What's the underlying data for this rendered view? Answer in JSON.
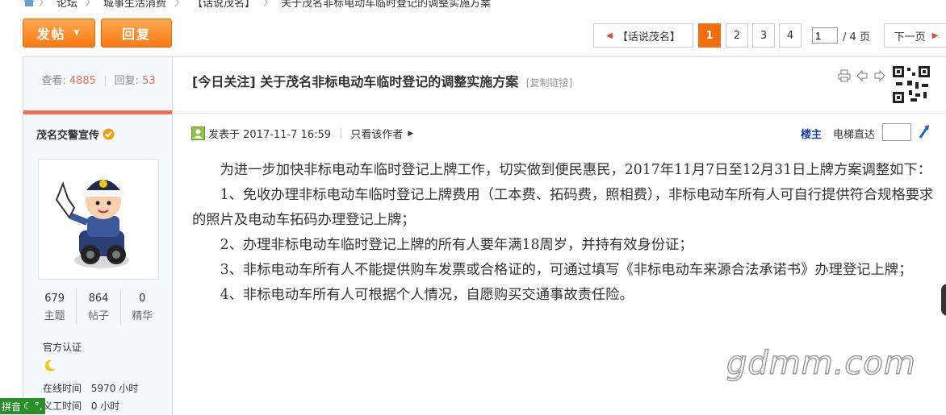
{
  "breadcrumb": {
    "items": [
      "论坛",
      "城事生活消费",
      "【话说茂名】",
      "关于茂名非标电动车临时登记的调整实施方案"
    ]
  },
  "toolbar": {
    "post_label": "发帖",
    "reply_label": "回复"
  },
  "pagination": {
    "back_label": "【话说茂名】",
    "pages": [
      "1",
      "2",
      "3",
      "4"
    ],
    "current_page": "1",
    "page_input": "1",
    "total_label": "/ 4 页",
    "next_label": "下一页"
  },
  "sidebar": {
    "views_label": "查看:",
    "views": "4885",
    "replies_label": "回复:",
    "replies": "53",
    "author": "茂名交警宣传",
    "stats": [
      {
        "value": "679",
        "label": "主题"
      },
      {
        "value": "864",
        "label": "帖子"
      },
      {
        "value": "0",
        "label": "精华"
      }
    ],
    "certification_label": "官方认证",
    "online_time_label": "在线时间",
    "online_time": "5970 小时",
    "work_time_label": "义工时间",
    "work_time": "0 小时"
  },
  "thread": {
    "title": "[今日关注] 关于茂名非标电动车临时登记的调整实施方案",
    "copy_link": "[复制链接]",
    "posted": "发表于 2017-11-7 16:59",
    "author_only": "只看该作者",
    "floor": "楼主",
    "jump_label": "电梯直达",
    "paragraphs": [
      "为进一步加快非标电动车临时登记上牌工作，切实做到便民惠民，2017年11月7日至12月31日上牌方案调整如下：",
      "1、免收办理非标电动车临时登记上牌费用（工本费、拓码费，照相费），非标电动车所有人可自行提供符合规格要求的照片及电动车拓码办理登记上牌；",
      "2、办理非标电动车临时登记上牌的所有人要年满18周岁，并持有效身份证；",
      "3、非标电动车所有人不能提供购车发票或合格证的，可通过填写《非标电动车来源合法承诺书》办理登记上牌；",
      "4、非标电动车所有人可根据个人情况，自愿购买交通事故责任险。"
    ]
  },
  "watermark": "gdmm.com",
  "ime": {
    "label": "拼音"
  },
  "colors": {
    "accent_orange": "#f57b14",
    "stat_number": "#f26c4f",
    "floor_blue": "#1a3fa6",
    "sidebar_bg": "#f3f9fd"
  }
}
